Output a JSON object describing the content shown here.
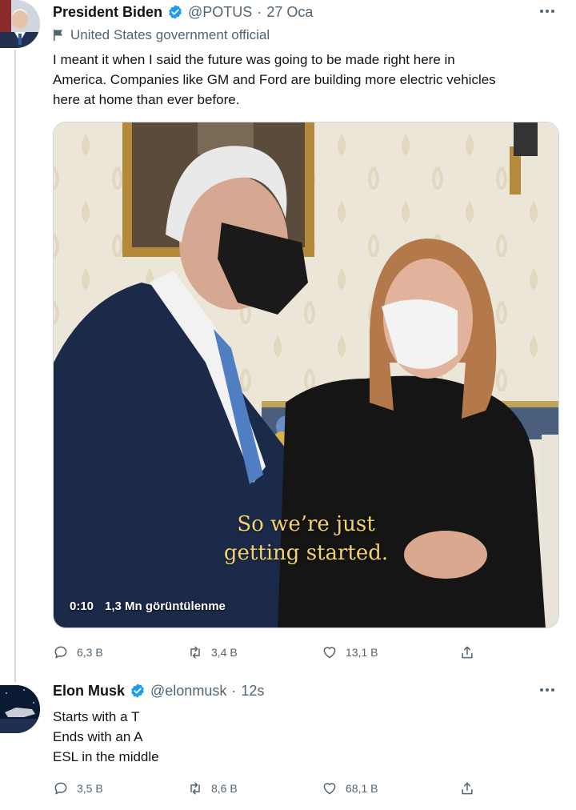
{
  "tweets": [
    {
      "author": {
        "name": "President Biden",
        "handle": "@POTUS",
        "date": "27 Oca"
      },
      "label": "United States government official",
      "text_lines": [
        "I meant it when I said the future was going to be made right here in",
        "America. Companies like GM and Ford are building more electric vehicles",
        "here at home than ever before."
      ],
      "media": {
        "caption_lines": [
          "So we’re just",
          "getting started."
        ],
        "duration": "0:10",
        "views": "1,3 Mn görüntülenme"
      },
      "stats": {
        "replies": "6,3 B",
        "retweets": "3,4 B",
        "likes": "13,1 B"
      }
    },
    {
      "author": {
        "name": "Elon Musk",
        "handle": "@elonmusk",
        "date": "12s"
      },
      "text_lines": [
        "Starts with a T",
        "Ends with an A",
        "ESL in the middle"
      ],
      "stats": {
        "replies": "3,5 B",
        "retweets": "8,6 B",
        "likes": "68,1 B"
      }
    }
  ],
  "colors": {
    "verified": "#1d9bf0",
    "secondary_text": "#536471",
    "caption": "#f4d36a"
  },
  "icons": [
    "verified-badge-icon",
    "flag-icon",
    "more-icon",
    "reply-icon",
    "retweet-icon",
    "like-icon",
    "share-icon"
  ]
}
